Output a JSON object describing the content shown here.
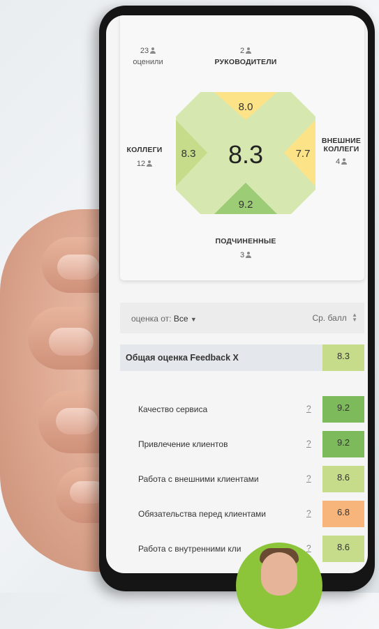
{
  "colors": {
    "green_light": "#c6dc8a",
    "green_mid": "#9ccc75",
    "green_dark": "#7dba5c",
    "yellow": "#fde387",
    "orange": "#f7b57b",
    "total_bg": "#e4e8ec"
  },
  "summary": {
    "rated_count": "23",
    "rated_label": "оценили",
    "managers": {
      "label": "РУКОВОДИТЕЛИ",
      "count": "2",
      "score": "8.0"
    },
    "colleagues": {
      "label": "КОЛЛЕГИ",
      "count": "12",
      "score": "8.3"
    },
    "external": {
      "label_line1": "ВНЕШНИЕ",
      "label_line2": "КОЛЛЕГИ",
      "count": "4",
      "score": "7.7"
    },
    "subordinates": {
      "label": "ПОДЧИНЕННЫЕ",
      "count": "3",
      "score": "9.2"
    },
    "overall_score": "8.3"
  },
  "filter": {
    "label": "оценка от:",
    "value": "Все",
    "sort_label": "Ср. балл"
  },
  "total_row": {
    "label": "Общая оценка Feedback X",
    "score": "8.3"
  },
  "rows": [
    {
      "label": "Качество сервиса",
      "help": "?",
      "score": "9.2"
    },
    {
      "label": "Привлечение клиентов",
      "help": "?",
      "score": "9.2"
    },
    {
      "label": "Работа с внешними клиентами",
      "help": "?",
      "score": "8.6"
    },
    {
      "label": "Обязательства перед клиентами",
      "help": "?",
      "score": "6.8"
    },
    {
      "label": "Работа с внутренними кли",
      "help": "?",
      "score": "8.6"
    }
  ]
}
